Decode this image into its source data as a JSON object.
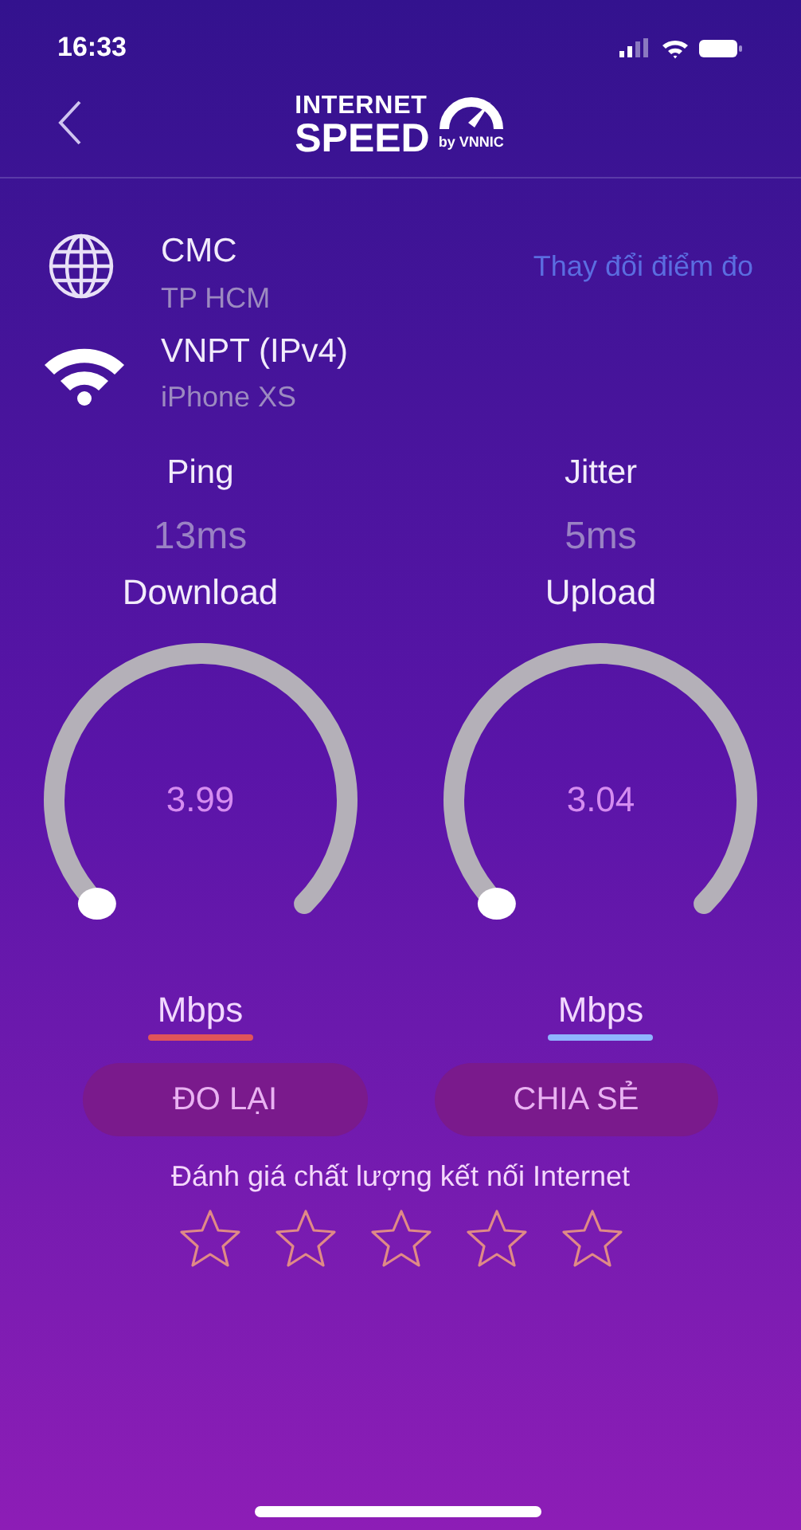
{
  "status_bar": {
    "time": "16:33"
  },
  "header": {
    "logo": {
      "line_1": "INTERNET",
      "line_2": "SPEED",
      "byline": "by VNNIC"
    }
  },
  "server": {
    "name": "CMC",
    "location": "TP HCM",
    "change_link": "Thay đổi điểm đo"
  },
  "connection": {
    "name": "VNPT (IPv4)",
    "device": "iPhone XS"
  },
  "metrics": [
    {
      "label": "Ping",
      "value": "13ms"
    },
    {
      "label": "Jitter",
      "value": "5ms"
    }
  ],
  "gauges": [
    {
      "label": "Download",
      "reading": "3.99",
      "unit": "Mbps",
      "color": "#e0545a"
    },
    {
      "label": "Upload",
      "reading": "3.04",
      "unit": "Mbps",
      "color": "#8fb4ff"
    }
  ],
  "buttons": [
    "ĐO LẠI",
    "CHIA SẺ"
  ],
  "rating": {
    "prompt": "Đánh giá chất lượng kết nối Internet",
    "stars": 0
  }
}
